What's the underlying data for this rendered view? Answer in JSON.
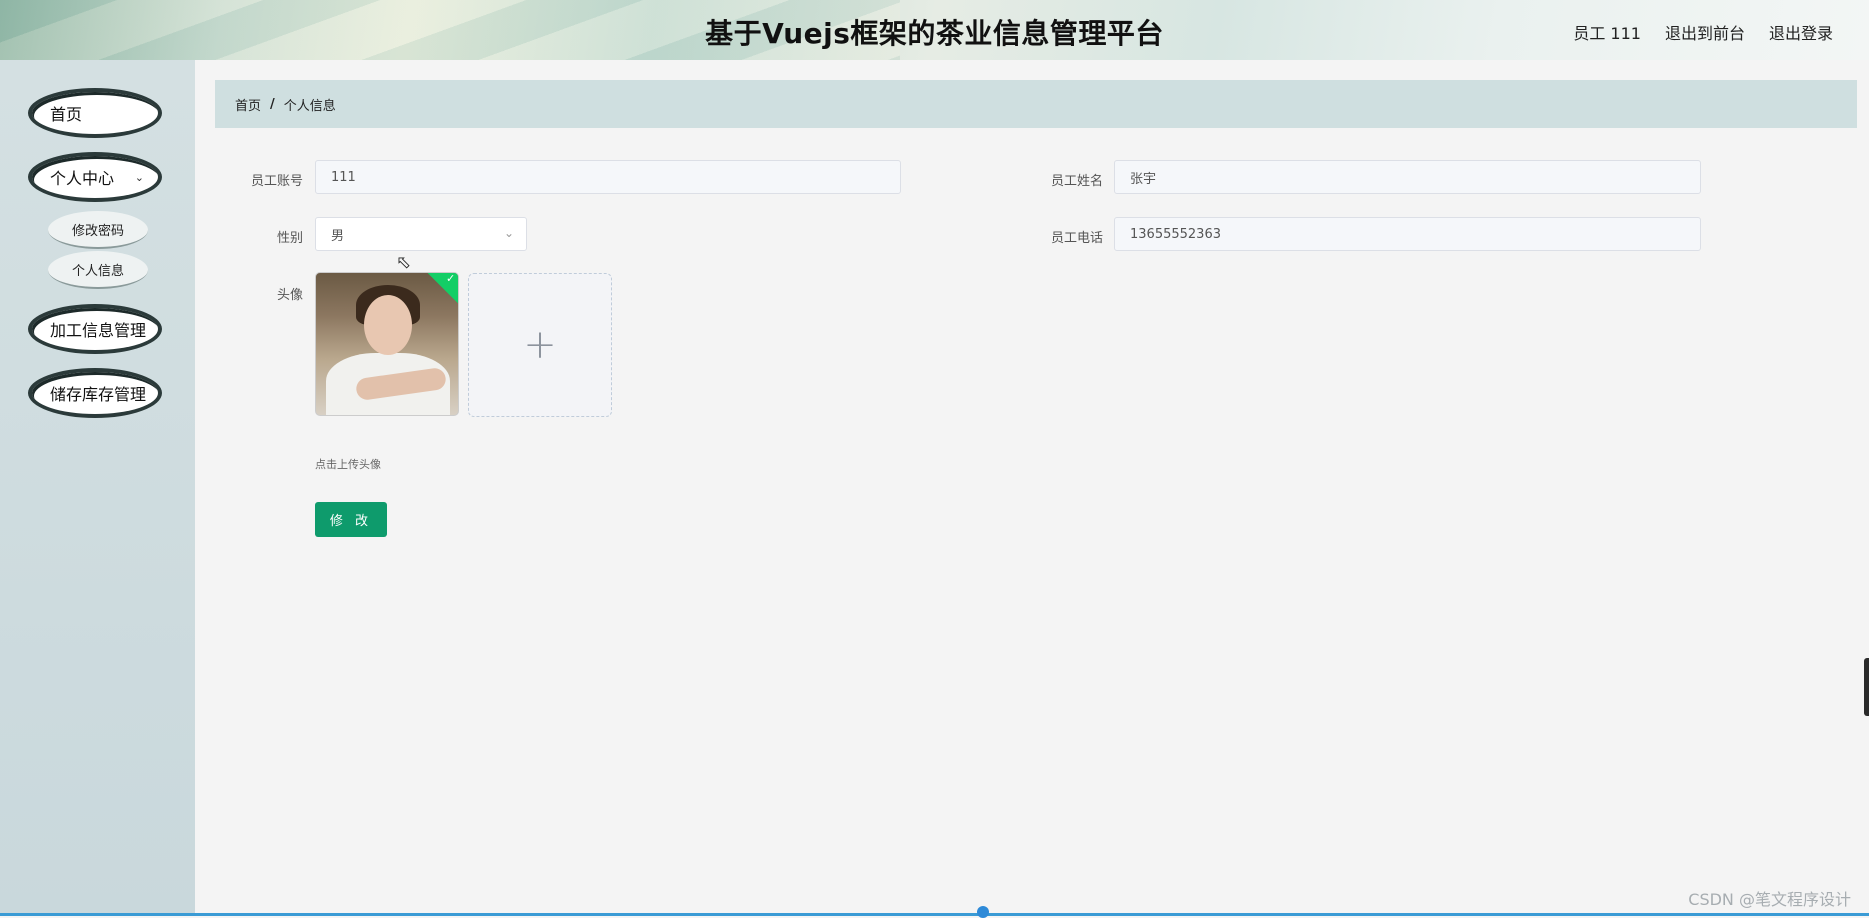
{
  "header": {
    "title": "基于Vuejs框架的茶业信息管理平台",
    "user": "员工 111",
    "back_to_front": "退出到前台",
    "logout": "退出登录"
  },
  "sidebar": {
    "home": "首页",
    "personal_center": "个人中心",
    "sub_change_password": "修改密码",
    "sub_personal_info": "个人信息",
    "processing": "加工信息管理",
    "storage": "储存库存管理"
  },
  "breadcrumb": {
    "home": "首页",
    "separator": "/",
    "current": "个人信息"
  },
  "form": {
    "account_label": "员工账号",
    "account_value": "111",
    "name_label": "员工姓名",
    "name_value": "张宇",
    "gender_label": "性别",
    "gender_value": "男",
    "phone_label": "员工电话",
    "phone_value": "13655552363",
    "avatar_label": "头像",
    "upload_hint": "点击上传头像",
    "submit_label": "修 改"
  },
  "watermark": "CSDN @笔文程序设计",
  "colors": {
    "primary_button": "#0e9b6c",
    "breadcrumb_bg": "#cfdfe0",
    "upload_success": "#13ce66"
  }
}
